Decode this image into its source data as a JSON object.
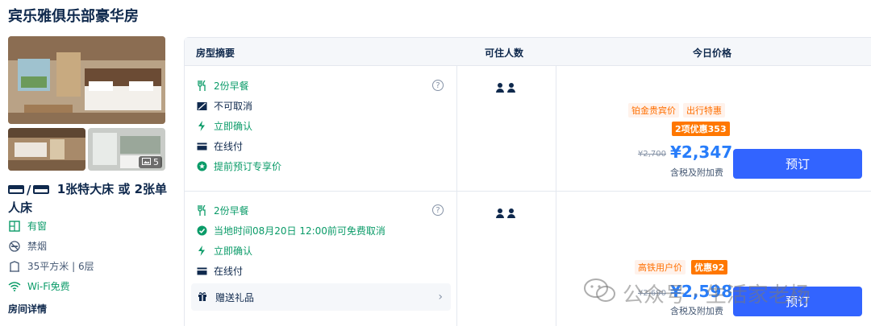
{
  "hotel": {
    "room_type_title": "宾乐雅俱乐部豪华房"
  },
  "gallery": {
    "photo_count": "5"
  },
  "room": {
    "bed_text": " / ",
    "bed_desc": "1张特大床 或 2张单人床",
    "attributes": [
      {
        "label": "有窗",
        "icon": "window-icon"
      },
      {
        "label": "禁烟",
        "icon": "no-smoking-icon"
      },
      {
        "label": "35平方米 | 6层",
        "icon": "area-icon"
      },
      {
        "label": "Wi-Fi免费",
        "icon": "wifi-icon"
      }
    ],
    "detail_link": "房间详情"
  },
  "table": {
    "headers": {
      "summary": "房型摘要",
      "occupancy": "可住人数",
      "price": "今日价格"
    }
  },
  "offers": [
    {
      "features": [
        {
          "label": "2份早餐",
          "icon": "utensils-icon",
          "tone": "green"
        },
        {
          "label": "不可取消",
          "icon": "no-cancel-icon",
          "tone": "dark"
        },
        {
          "label": "立即确认",
          "icon": "lightning-icon",
          "tone": "green"
        },
        {
          "label": "在线付",
          "icon": "card-icon",
          "tone": "dark"
        },
        {
          "label": "提前预订专享价",
          "icon": "star-badge-icon",
          "tone": "green"
        }
      ],
      "tags": [
        "铂金贵宾价",
        "出行特惠"
      ],
      "discount": "2项优惠353",
      "old_price": "¥2,700",
      "price": "¥2,347",
      "tax_note": "含税及附加费",
      "book_label": "预订"
    },
    {
      "features": [
        {
          "label": "2份早餐",
          "icon": "utensils-icon",
          "tone": "green"
        },
        {
          "label": "当地时间08月20日 12:00前可免费取消",
          "icon": "check-circle-icon",
          "tone": "green"
        },
        {
          "label": "立即确认",
          "icon": "lightning-icon",
          "tone": "green"
        },
        {
          "label": "在线付",
          "icon": "card-icon",
          "tone": "dark"
        }
      ],
      "gift_label": "赠送礼品",
      "tags": [
        "高铁用户价"
      ],
      "discount": "优惠92",
      "old_price": "¥2,690",
      "price": "¥2,598",
      "tax_note": "含税及附加费",
      "book_label": "预订"
    }
  ],
  "watermark": {
    "text": "公众号 · 生活家老杨"
  },
  "colors": {
    "green": "#0a9b68",
    "price_blue": "#287dfa",
    "button_blue": "#3264ff",
    "orange": "#ff7700"
  }
}
